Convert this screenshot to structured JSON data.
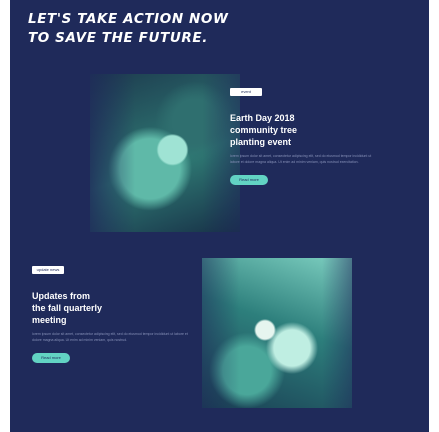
{
  "header": {
    "line1": "LET'S TAKE ACTION NOW",
    "line2": "TO SAVE THE FUTURE."
  },
  "cards": [
    {
      "tag": "event",
      "title_lines": [
        "Earth Day 2018",
        "community tree",
        "planting event"
      ],
      "body": "lorem ipsum dolor sit amet, consectetur adipiscing elit, sed do eiusmod tempor incididunt ut labore et dolore magna aliqua. Ut enim ad minim veniam, quis nostrud exercitation.",
      "button": "Read more"
    },
    {
      "tag": "update news",
      "title_lines": [
        "Updates from",
        "the fall quarterly",
        "meeting"
      ],
      "body": "lorem ipsum dolor sit amet, consectetur adipiscing elit, sed do eiusmod tempor incididunt ut labore et dolore magna aliqua. Ut enim ad minim veniam, quis nostrud.",
      "button": "Read more"
    }
  ],
  "colors": {
    "background": "#1f2a5a",
    "accent": "#62d3c3",
    "text": "#ffffff"
  }
}
